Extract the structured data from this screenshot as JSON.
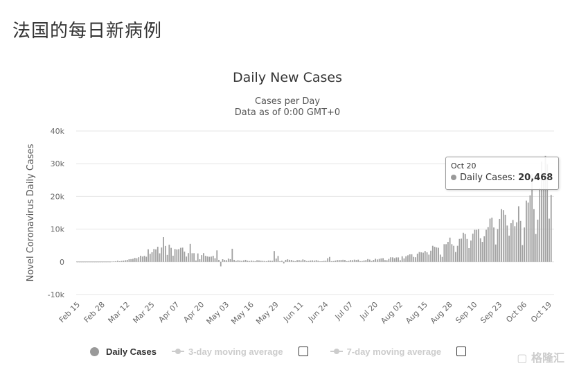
{
  "page": {
    "title": "法国的每日新病例",
    "watermark": "格隆汇"
  },
  "tooltip": {
    "date": "Oct 20",
    "series": "Daily Cases:",
    "value": "20,468"
  },
  "legend": {
    "items": [
      {
        "label": "Daily Cases",
        "active": true
      },
      {
        "label": "3-day moving average",
        "active": false
      },
      {
        "label": "7-day moving average",
        "active": false
      }
    ]
  },
  "colors": {
    "bar": "#a0a0a0",
    "grid": "#e6e6e6",
    "text": "#333333",
    "axis_text": "#666666",
    "inactive": "#cccccc"
  },
  "chart_data": {
    "type": "bar",
    "title": "Daily New Cases",
    "subtitle": [
      "Cases per Day",
      "Data as of 0:00 GMT+0"
    ],
    "xlabel": "",
    "ylabel": "Novel Coronavirus Daily Cases",
    "ylim": [
      -10000,
      40000
    ],
    "yticks": [
      {
        "v": 40000,
        "label": "40k"
      },
      {
        "v": 30000,
        "label": "30k"
      },
      {
        "v": 20000,
        "label": "20k"
      },
      {
        "v": 10000,
        "label": "10k"
      },
      {
        "v": 0,
        "label": "0"
      },
      {
        "v": -10000,
        "label": "-10k"
      }
    ],
    "xtick_labels": [
      "Feb 15",
      "Feb 28",
      "Mar 12",
      "Mar 25",
      "Apr 07",
      "Apr 20",
      "May 03",
      "May 16",
      "May 29",
      "Jun 11",
      "Jun 24",
      "Jul 07",
      "Jul 20",
      "Aug 02",
      "Aug 15",
      "Aug 28",
      "Sep 10",
      "Sep 23",
      "Oct 06",
      "Oct 19"
    ],
    "grid": true,
    "legend_position": "bottom",
    "series": [
      {
        "name": "Daily Cases",
        "months": [
          {
            "month": "Feb",
            "first_day": 15,
            "values": [
              0,
              0,
              0,
              0,
              0,
              0,
              0,
              0,
              0,
              0,
              0,
              2,
              19,
              0,
              43
            ]
          },
          {
            "month": "Mar",
            "first_day": 1,
            "values": [
              30,
              61,
              21,
              73,
              138,
              190,
              336,
              177,
              286,
              372,
              497,
              595,
              785,
              838,
              924,
              1210,
              1097,
              1404,
              1861,
              1617,
              1847,
              1559,
              3838,
              2446,
              2931,
              3922,
              3809,
              4611,
              2599,
              4376,
              7578
            ]
          },
          {
            "month": "Apr",
            "first_day": 1,
            "values": [
              4861,
              2116,
              5233,
              4267,
              1873,
              3912,
              3777,
              3881,
              4286,
              4342,
              3114,
              1613,
              2673,
              5497,
              2633,
              2641,
              405,
              2569,
              785,
              2051,
              2667,
              1827,
              1653,
              1541,
              1609,
              1843,
              1100,
              3500,
              600,
              -1400
            ]
          },
          {
            "month": "May",
            "first_day": 1,
            "values": [
              800,
              600,
              500,
              1000,
              800,
              4000,
              600,
              300,
              500,
              400,
              300,
              450,
              600,
              350,
              250,
              400,
              300,
              200,
              500,
              450,
              350,
              300,
              250,
              200,
              400,
              350,
              300,
              3300,
              1000,
              1800,
              200
            ]
          },
          {
            "month": "Jun",
            "first_day": 1,
            "values": [
              340,
              -500,
              600,
              770,
              610,
              580,
              350,
              200,
              520,
              550,
              420,
              730,
              580,
              230,
              260,
              410,
              460,
              390,
              520,
              330,
              150,
              180,
              290,
              330,
              1100,
              1500,
              200,
              230,
              380,
              540
            ]
          },
          {
            "month": "Jul",
            "first_day": 1,
            "values": [
              560,
              580,
              630,
              580,
              200,
              280,
              550,
              520,
              660,
              560,
              660,
              200,
              240,
              420,
              540,
              850,
              680,
              250,
              590,
              940,
              730,
              900,
              1060,
              1130,
              550,
              500,
              900,
              1390,
              1370,
              1130,
              1350
            ]
          },
          {
            "month": "Aug",
            "first_day": 1,
            "values": [
              1350,
              500,
              1700,
              1040,
              1700,
              2000,
              2300,
              2300,
              1500,
              1400,
              2500,
              3000,
              2900,
              2800,
              3300,
              2900,
              2200,
              3400,
              4900,
              4600,
              4400,
              4300,
              2200,
              1500,
              5400,
              5400,
              6100,
              7400,
              5400,
              4900,
              3000
            ]
          },
          {
            "month": "Sep",
            "first_day": 1,
            "values": [
              4900,
              7000,
              7100,
              8900,
              8500,
              7000,
              4200,
              6500,
              8600,
              9800,
              9800,
              10000,
              7200,
              6100,
              7800,
              9800,
              10600,
              13200,
              13500,
              10500,
              5300,
              10000,
              13100,
              16100,
              15800,
              14400,
              11100,
              8000,
              11800,
              12800
            ]
          },
          {
            "month": "Oct",
            "first_day": 1,
            "values": [
              10900,
              12100,
              17000,
              12500,
              5100,
              10500,
              18700,
              18100,
              20300,
              26900,
              16100,
              8500,
              12900,
              22600,
              30600,
              25100,
              32400,
              29800,
              13200,
              20468
            ]
          }
        ]
      }
    ]
  }
}
